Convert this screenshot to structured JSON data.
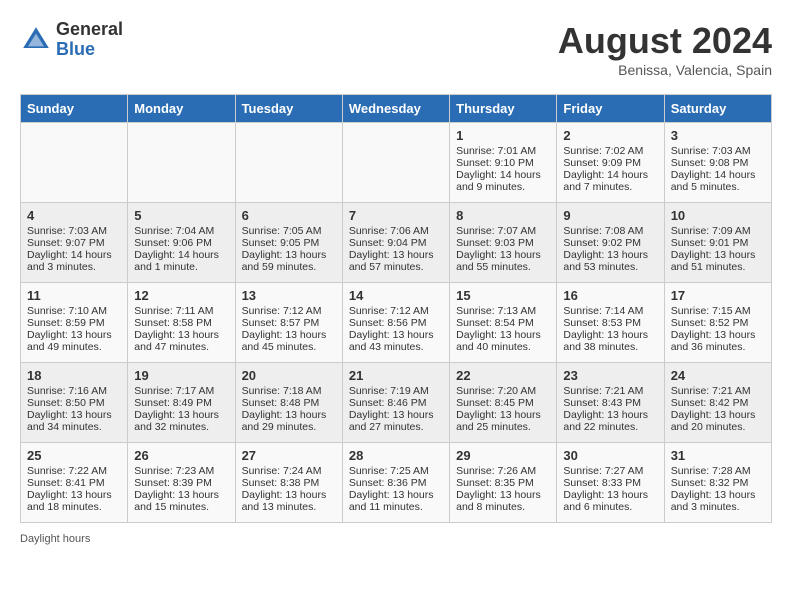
{
  "header": {
    "logo_general": "General",
    "logo_blue": "Blue",
    "month_year": "August 2024",
    "location": "Benissa, Valencia, Spain"
  },
  "days_of_week": [
    "Sunday",
    "Monday",
    "Tuesday",
    "Wednesday",
    "Thursday",
    "Friday",
    "Saturday"
  ],
  "weeks": [
    [
      {
        "day": "",
        "sunrise": "",
        "sunset": "",
        "daylight": ""
      },
      {
        "day": "",
        "sunrise": "",
        "sunset": "",
        "daylight": ""
      },
      {
        "day": "",
        "sunrise": "",
        "sunset": "",
        "daylight": ""
      },
      {
        "day": "",
        "sunrise": "",
        "sunset": "",
        "daylight": ""
      },
      {
        "day": "1",
        "sunrise": "Sunrise: 7:01 AM",
        "sunset": "Sunset: 9:10 PM",
        "daylight": "Daylight: 14 hours and 9 minutes."
      },
      {
        "day": "2",
        "sunrise": "Sunrise: 7:02 AM",
        "sunset": "Sunset: 9:09 PM",
        "daylight": "Daylight: 14 hours and 7 minutes."
      },
      {
        "day": "3",
        "sunrise": "Sunrise: 7:03 AM",
        "sunset": "Sunset: 9:08 PM",
        "daylight": "Daylight: 14 hours and 5 minutes."
      }
    ],
    [
      {
        "day": "4",
        "sunrise": "Sunrise: 7:03 AM",
        "sunset": "Sunset: 9:07 PM",
        "daylight": "Daylight: 14 hours and 3 minutes."
      },
      {
        "day": "5",
        "sunrise": "Sunrise: 7:04 AM",
        "sunset": "Sunset: 9:06 PM",
        "daylight": "Daylight: 14 hours and 1 minute."
      },
      {
        "day": "6",
        "sunrise": "Sunrise: 7:05 AM",
        "sunset": "Sunset: 9:05 PM",
        "daylight": "Daylight: 13 hours and 59 minutes."
      },
      {
        "day": "7",
        "sunrise": "Sunrise: 7:06 AM",
        "sunset": "Sunset: 9:04 PM",
        "daylight": "Daylight: 13 hours and 57 minutes."
      },
      {
        "day": "8",
        "sunrise": "Sunrise: 7:07 AM",
        "sunset": "Sunset: 9:03 PM",
        "daylight": "Daylight: 13 hours and 55 minutes."
      },
      {
        "day": "9",
        "sunrise": "Sunrise: 7:08 AM",
        "sunset": "Sunset: 9:02 PM",
        "daylight": "Daylight: 13 hours and 53 minutes."
      },
      {
        "day": "10",
        "sunrise": "Sunrise: 7:09 AM",
        "sunset": "Sunset: 9:01 PM",
        "daylight": "Daylight: 13 hours and 51 minutes."
      }
    ],
    [
      {
        "day": "11",
        "sunrise": "Sunrise: 7:10 AM",
        "sunset": "Sunset: 8:59 PM",
        "daylight": "Daylight: 13 hours and 49 minutes."
      },
      {
        "day": "12",
        "sunrise": "Sunrise: 7:11 AM",
        "sunset": "Sunset: 8:58 PM",
        "daylight": "Daylight: 13 hours and 47 minutes."
      },
      {
        "day": "13",
        "sunrise": "Sunrise: 7:12 AM",
        "sunset": "Sunset: 8:57 PM",
        "daylight": "Daylight: 13 hours and 45 minutes."
      },
      {
        "day": "14",
        "sunrise": "Sunrise: 7:12 AM",
        "sunset": "Sunset: 8:56 PM",
        "daylight": "Daylight: 13 hours and 43 minutes."
      },
      {
        "day": "15",
        "sunrise": "Sunrise: 7:13 AM",
        "sunset": "Sunset: 8:54 PM",
        "daylight": "Daylight: 13 hours and 40 minutes."
      },
      {
        "day": "16",
        "sunrise": "Sunrise: 7:14 AM",
        "sunset": "Sunset: 8:53 PM",
        "daylight": "Daylight: 13 hours and 38 minutes."
      },
      {
        "day": "17",
        "sunrise": "Sunrise: 7:15 AM",
        "sunset": "Sunset: 8:52 PM",
        "daylight": "Daylight: 13 hours and 36 minutes."
      }
    ],
    [
      {
        "day": "18",
        "sunrise": "Sunrise: 7:16 AM",
        "sunset": "Sunset: 8:50 PM",
        "daylight": "Daylight: 13 hours and 34 minutes."
      },
      {
        "day": "19",
        "sunrise": "Sunrise: 7:17 AM",
        "sunset": "Sunset: 8:49 PM",
        "daylight": "Daylight: 13 hours and 32 minutes."
      },
      {
        "day": "20",
        "sunrise": "Sunrise: 7:18 AM",
        "sunset": "Sunset: 8:48 PM",
        "daylight": "Daylight: 13 hours and 29 minutes."
      },
      {
        "day": "21",
        "sunrise": "Sunrise: 7:19 AM",
        "sunset": "Sunset: 8:46 PM",
        "daylight": "Daylight: 13 hours and 27 minutes."
      },
      {
        "day": "22",
        "sunrise": "Sunrise: 7:20 AM",
        "sunset": "Sunset: 8:45 PM",
        "daylight": "Daylight: 13 hours and 25 minutes."
      },
      {
        "day": "23",
        "sunrise": "Sunrise: 7:21 AM",
        "sunset": "Sunset: 8:43 PM",
        "daylight": "Daylight: 13 hours and 22 minutes."
      },
      {
        "day": "24",
        "sunrise": "Sunrise: 7:21 AM",
        "sunset": "Sunset: 8:42 PM",
        "daylight": "Daylight: 13 hours and 20 minutes."
      }
    ],
    [
      {
        "day": "25",
        "sunrise": "Sunrise: 7:22 AM",
        "sunset": "Sunset: 8:41 PM",
        "daylight": "Daylight: 13 hours and 18 minutes."
      },
      {
        "day": "26",
        "sunrise": "Sunrise: 7:23 AM",
        "sunset": "Sunset: 8:39 PM",
        "daylight": "Daylight: 13 hours and 15 minutes."
      },
      {
        "day": "27",
        "sunrise": "Sunrise: 7:24 AM",
        "sunset": "Sunset: 8:38 PM",
        "daylight": "Daylight: 13 hours and 13 minutes."
      },
      {
        "day": "28",
        "sunrise": "Sunrise: 7:25 AM",
        "sunset": "Sunset: 8:36 PM",
        "daylight": "Daylight: 13 hours and 11 minutes."
      },
      {
        "day": "29",
        "sunrise": "Sunrise: 7:26 AM",
        "sunset": "Sunset: 8:35 PM",
        "daylight": "Daylight: 13 hours and 8 minutes."
      },
      {
        "day": "30",
        "sunrise": "Sunrise: 7:27 AM",
        "sunset": "Sunset: 8:33 PM",
        "daylight": "Daylight: 13 hours and 6 minutes."
      },
      {
        "day": "31",
        "sunrise": "Sunrise: 7:28 AM",
        "sunset": "Sunset: 8:32 PM",
        "daylight": "Daylight: 13 hours and 3 minutes."
      }
    ]
  ],
  "footer": {
    "note": "Daylight hours"
  }
}
